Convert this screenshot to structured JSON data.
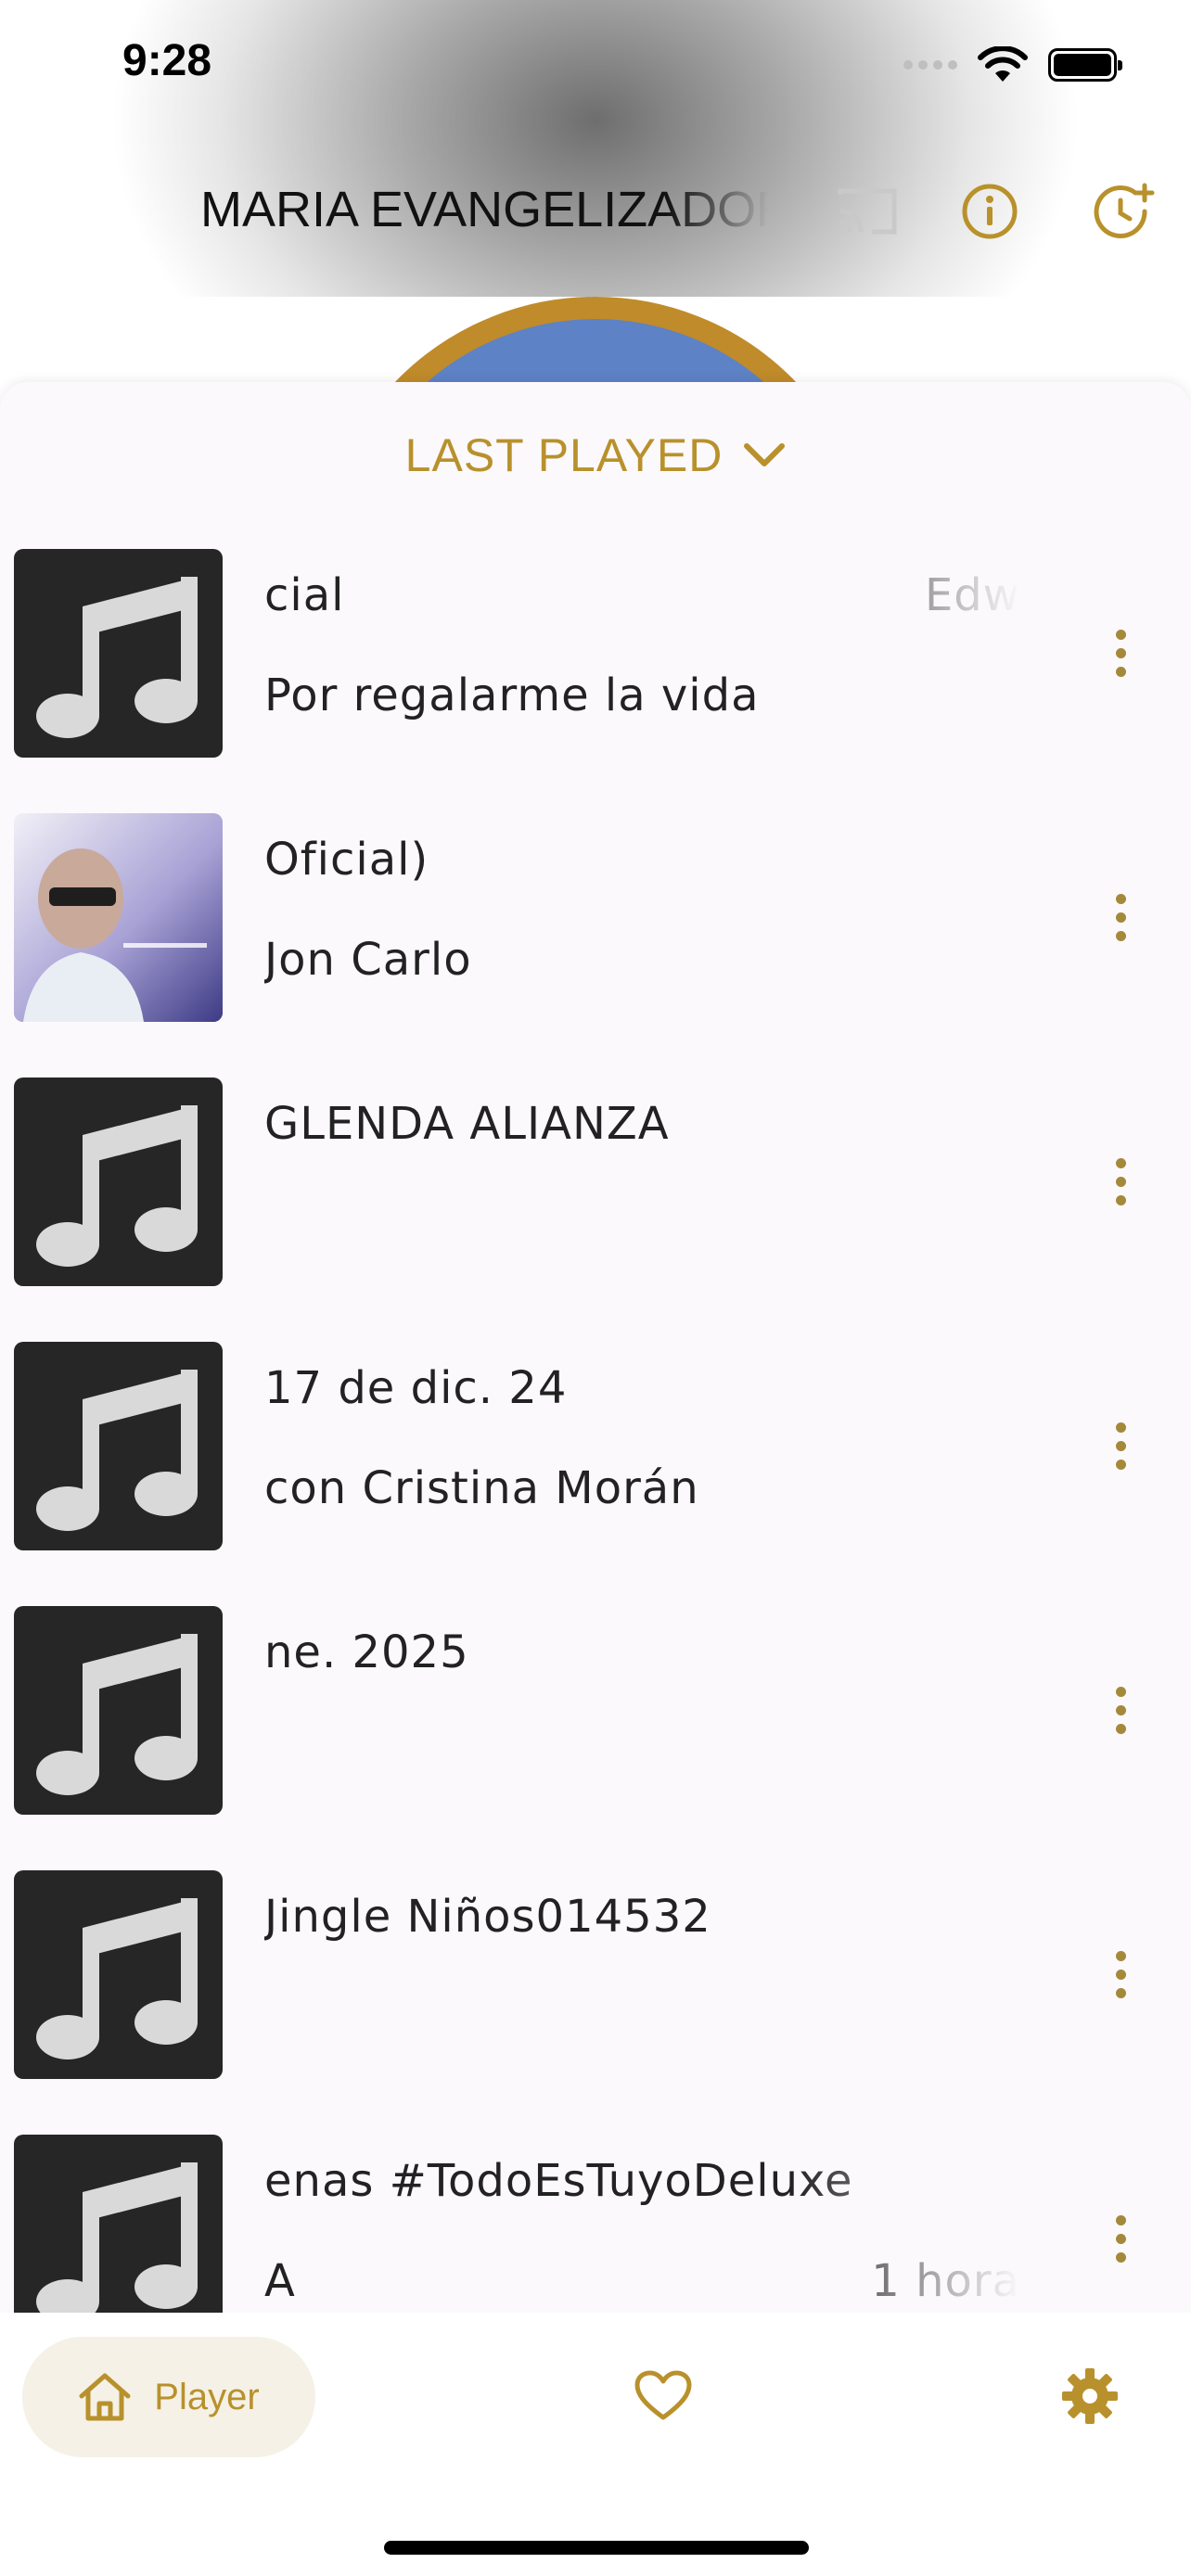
{
  "status_bar": {
    "time": "9:28"
  },
  "header": {
    "title": "MARIA EVANGELIZADORA"
  },
  "sheet": {
    "title": "LAST PLAYED"
  },
  "tracks": [
    {
      "line1": "cial",
      "line1_right": "Edw",
      "line2": "Por regalarme la vida",
      "thumb": "music-note"
    },
    {
      "line1": " Oficial)",
      "line2": "Jon Carlo",
      "thumb": "photo"
    },
    {
      "line1": "GLENDA ALIANZA",
      "line2": "",
      "thumb": "music-note"
    },
    {
      "line1": "17 de dic. 24",
      "line2": "con Cristina Morán",
      "thumb": "music-note"
    },
    {
      "line1": "ne. 2025",
      "line2": "",
      "thumb": "music-note"
    },
    {
      "line1": "Jingle Niños014532",
      "line2": "",
      "thumb": "music-note"
    },
    {
      "line1": "enas #TodoEsTuyoDeluxe",
      "line2": "A",
      "line2_right": "1 hora",
      "thumb": "music-note"
    }
  ],
  "tabbar": {
    "player_label": "Player"
  },
  "colors": {
    "accent": "#b8912c",
    "sheet_bg": "#fcf9fc",
    "thumb_bg": "#262626"
  },
  "icons": [
    "wifi-icon",
    "battery-icon",
    "cast-icon",
    "info-icon",
    "timer-icon",
    "chevron-down-icon",
    "music-note-icon",
    "more-vertical-icon",
    "home-icon",
    "heart-icon",
    "gear-icon"
  ]
}
